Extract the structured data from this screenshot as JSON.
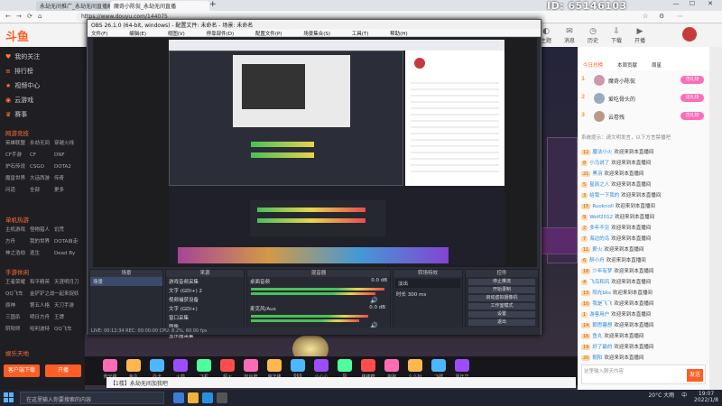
{
  "browser": {
    "tabs": [
      {
        "label": "永劫无间推广_永劫无间直播解说",
        "active": false
      },
      {
        "label": "魔奇小陈侃_永劫无间直播",
        "active": true
      }
    ],
    "new_tab": "+",
    "address": "https://www.douyu.com/144075",
    "watermark": "ID: 65146103"
  },
  "site": {
    "logo": "斗鱼",
    "header_icons": [
      "主题",
      "消息",
      "历史",
      "下载",
      "开播"
    ]
  },
  "sidebar": {
    "nav": [
      {
        "icon": "heart-icon",
        "label": "我的关注"
      },
      {
        "icon": "list-icon",
        "label": "排行榜"
      },
      {
        "icon": "star-icon",
        "label": "视频中心"
      },
      {
        "icon": "gamepad-icon",
        "label": "云游戏"
      },
      {
        "icon": "trophy-icon",
        "label": "赛事"
      }
    ],
    "sections": [
      {
        "title": "网游竞技",
        "items": [
          "英雄联盟",
          "永劫无间",
          "穿越火线",
          "CF手游",
          "CF",
          "DNF",
          "炉石传说",
          "CSGO",
          "DOTA2",
          "魔兽世界",
          "大话西游",
          "传奇",
          "问道",
          "全部",
          "更多"
        ]
      },
      {
        "title": "单机热游",
        "items": [
          "主机游戏",
          "怪物猎人",
          "饥荒",
          "方舟",
          "我的世界",
          "DOTA自走棋",
          "神之浩劫",
          "逃生",
          "Dead By"
        ]
      },
      {
        "title": "手游休闲",
        "items": [
          "王者荣耀",
          "和平精英",
          "天涯明月刀",
          "QQ飞车",
          "金铲铲之战",
          "一起来捉妖",
          "原神",
          "第五人格",
          "天刀手游",
          "三国杀",
          "明日方舟",
          "王牌",
          "阴阳师",
          "哈利波特",
          "QQ飞车"
        ]
      }
    ],
    "footer_title": "娱乐天地",
    "btn_open": "客户端下载",
    "btn_stream": "开播"
  },
  "obs": {
    "title": "OBS 26.1.0 (64-bit, windows) - 配置文件: 未命名 - 场景: 未命名",
    "menu": [
      "文件(F)",
      "编辑(E)",
      "视图(V)",
      "停靠部件(D)",
      "配置文件(P)",
      "场景集合(S)",
      "工具(T)",
      "帮助(H)"
    ],
    "docks": {
      "scenes": {
        "title": "场景",
        "items": [
          "场景"
        ]
      },
      "sources": {
        "title": "来源",
        "items": [
          "游戏音频采集",
          "文字 (GDI+) 2",
          "视频捕获设备",
          "文字 (GDI+)",
          "窗口采集",
          "图像",
          "显示器采集"
        ]
      },
      "mixer": {
        "title": "混音器",
        "items": [
          {
            "name": "桌面音频",
            "db": "0.0 dB"
          },
          {
            "name": "麦克风/Aux",
            "db": "0.0 dB"
          }
        ]
      },
      "transitions": {
        "title": "转场特效",
        "type": "淡出",
        "duration_label": "时长",
        "duration": "300 ms"
      },
      "controls": {
        "title": "控件",
        "buttons": [
          "停止推流",
          "开始录制",
          "启动虚拟摄像机",
          "工作室模式",
          "设置",
          "退出"
        ]
      }
    },
    "status": "LIVE: 00:12:34  REC: 00:00:00  CPU: 8.2%, 60.00 fps"
  },
  "chat": {
    "tabs": [
      "今日总榜",
      "本周贡献",
      "周星"
    ],
    "ranking": [
      {
        "rank": "1",
        "name": "魔奇小陈侃",
        "badge": "送礼物"
      },
      {
        "rank": "2",
        "name": "爱吃骨头的",
        "badge": "送礼物"
      },
      {
        "rank": "3",
        "name": "云卷残",
        "badge": "送礼物"
      }
    ],
    "notice": "系统提示：请文明发言，以下方言禁播吧",
    "messages": [
      {
        "level": "12",
        "name": "魔法小火",
        "text": "欢迎来到本直播间"
      },
      {
        "level": "8",
        "name": "小马说了",
        "text": "欢迎来到本直播间"
      },
      {
        "level": "21",
        "name": "黑羽",
        "text": "欢迎来到本直播间"
      },
      {
        "level": "5",
        "name": "星辰之人",
        "text": "欢迎来到本直播间"
      },
      {
        "level": "3",
        "name": "给我一下我的",
        "text": "欢迎来到本直播间"
      },
      {
        "level": "15",
        "name": "Ruoknoll",
        "text": "欢迎来到本直播间"
      },
      {
        "level": "9",
        "name": "Wolf2012",
        "text": "欢迎来到本直播间"
      },
      {
        "level": "2",
        "name": "多年不见",
        "text": "欢迎来到本直播间"
      },
      {
        "level": "7",
        "name": "海边的鸟",
        "text": "欢迎来到本直播间"
      },
      {
        "level": "11",
        "name": "薪火",
        "text": "欢迎来到本直播间"
      },
      {
        "level": "6",
        "name": "醉小舟",
        "text": "欢迎来到本直播间"
      },
      {
        "level": "18",
        "name": "少年有梦",
        "text": "欢迎来到本直播间"
      },
      {
        "level": "4",
        "name": "飞鸟和风",
        "text": "欢迎来到本直播间"
      },
      {
        "level": "13",
        "name": "阳光bks",
        "text": "欢迎来到本直播间"
      },
      {
        "level": "10",
        "name": "我是飞飞",
        "text": "欢迎来到本直播间"
      },
      {
        "level": "1",
        "name": "游客用户",
        "text": "欢迎来到本直播间"
      },
      {
        "level": "14",
        "name": "朝思暮想",
        "text": "欢迎来到本直播间"
      },
      {
        "level": "16",
        "name": "鱼丸",
        "text": "欢迎来到本直播间"
      },
      {
        "level": "19",
        "name": "好了最的",
        "text": "欢迎来到本直播间"
      },
      {
        "level": "20",
        "name": "朝阳",
        "text": "欢迎来到本直播间"
      }
    ],
    "input_placeholder": "这里输入聊天内容",
    "send": "发送"
  },
  "stream": {
    "info": "【1楼】永劫无间加我吧",
    "gifts": [
      "荧光棒",
      "鱼丸",
      "办卡",
      "火箭",
      "飞机",
      "超火",
      "粉丝牌",
      "魔法棒",
      "666",
      "小心心",
      "赞",
      "棒棒糖",
      "抱抱",
      "么么哒",
      "飞碟",
      "嘉年华"
    ]
  },
  "taskbar": {
    "search_placeholder": "在这里输入你要搜索的内容",
    "weather": "20°C 大雨",
    "time": "19:07",
    "date": "2022/1/8",
    "lang": "中"
  },
  "colors": {
    "accent": "#ff5d23",
    "chat_pill": "#ff6bb5",
    "meter_green": "#48c058"
  }
}
